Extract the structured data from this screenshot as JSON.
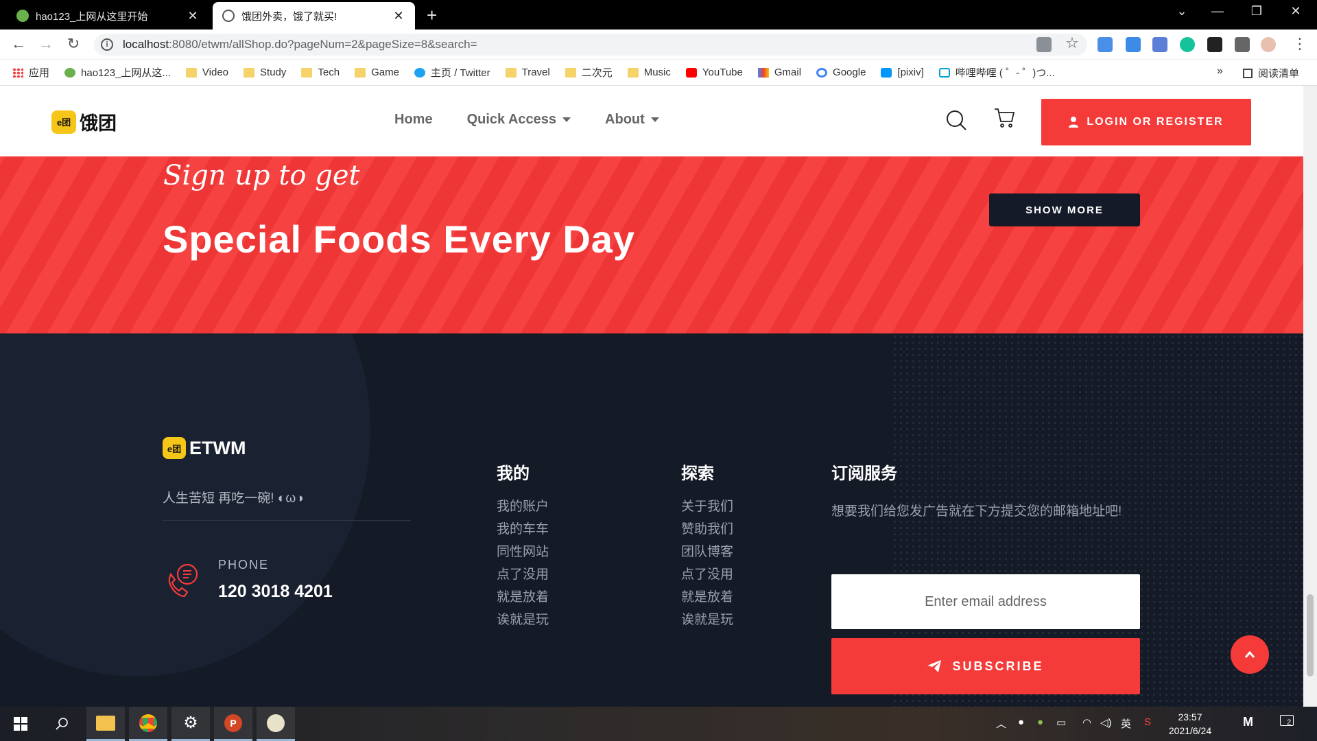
{
  "browser": {
    "tabs": [
      {
        "title": "hao123_上网从这里开始",
        "active": false
      },
      {
        "title": "饿团外卖，饿了就买!",
        "active": true
      }
    ],
    "new_tab": "+",
    "url_host": "localhost",
    "url_rest": ":8080/etwm/allShop.do?pageNum=2&pageSize=8&search=",
    "bookmarks": [
      {
        "label": "应用",
        "icon": "apps-grid-icon"
      },
      {
        "label": "hao123_上网从这...",
        "icon": "hao123-icon"
      },
      {
        "label": "Video",
        "icon": "folder-icon"
      },
      {
        "label": "Study",
        "icon": "folder-icon"
      },
      {
        "label": "Tech",
        "icon": "folder-icon"
      },
      {
        "label": "Game",
        "icon": "folder-icon"
      },
      {
        "label": "主页 / Twitter",
        "icon": "twitter-icon"
      },
      {
        "label": "Travel",
        "icon": "folder-icon"
      },
      {
        "label": "二次元",
        "icon": "folder-icon"
      },
      {
        "label": "Music",
        "icon": "folder-icon"
      },
      {
        "label": "YouTube",
        "icon": "youtube-icon"
      },
      {
        "label": "Gmail",
        "icon": "gmail-icon"
      },
      {
        "label": "Google",
        "icon": "google-icon"
      },
      {
        "label": "[pixiv]",
        "icon": "pixiv-icon"
      },
      {
        "label": "哔哩哔哩 ( ゜- ゜)つ...",
        "icon": "bilibili-icon"
      }
    ],
    "more": "»",
    "reading_list": "阅读清单"
  },
  "header": {
    "logo_badge": "e团",
    "logo_text": "饿团",
    "nav": [
      {
        "label": "Home"
      },
      {
        "label": "Quick Access"
      },
      {
        "label": "About"
      }
    ],
    "login_label": "LOGIN OR REGISTER"
  },
  "promo": {
    "script": "Sign up to get",
    "title": "Special Foods Every Day",
    "button": "SHOW MORE"
  },
  "footer": {
    "logo_badge": "e团",
    "logo_text": "ETWM",
    "slogan": "人生苦短 再吃一碗! ◐ω◑",
    "phone_label": "PHONE",
    "phone_number": "120 3018 4201",
    "columns": [
      {
        "title": "我的",
        "items": [
          "我的账户",
          "我的车车",
          "同性网站",
          "点了没用",
          "就是放着",
          "诶就是玩"
        ]
      },
      {
        "title": "探索",
        "items": [
          "关于我们",
          "赞助我们",
          "团队博客",
          "点了没用",
          "就是放着",
          "诶就是玩"
        ]
      }
    ],
    "subscribe_title": "订阅服务",
    "subscribe_text": "想要我们给您发广告就在下方提交您的邮箱地址吧!",
    "email_placeholder": "Enter email address",
    "subscribe_button": "SUBSCRIBE"
  },
  "taskbar": {
    "ime": "英",
    "time": "23:57",
    "date": "2021/6/24",
    "notification_count": "2"
  },
  "colors": {
    "accent": "#f53a3a",
    "dark": "#141a26",
    "logo_yellow": "#f5c518"
  }
}
